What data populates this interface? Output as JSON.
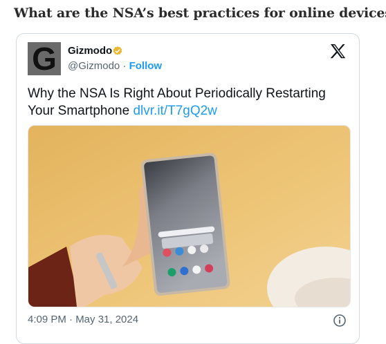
{
  "article": {
    "heading": "What are the NSA’s best practices for online devices?"
  },
  "tweet": {
    "avatar_letter": "G",
    "author_name": "Gizmodo",
    "handle": "@Gizmodo",
    "separator": " · ",
    "follow_label": "Follow",
    "text": "Why the NSA Is Right About Periodically Restarting Your Smartphone ",
    "link_text": "dlvr.it/T7gQ2w",
    "timestamp": "4:09 PM · May 31, 2024",
    "photo_description": "hand holding smartphone"
  },
  "colors": {
    "link": "#1d9bf0",
    "badge": "#e8b830",
    "text": "#0f1419",
    "muted": "#536471"
  },
  "icons": [
    "verified-badge-icon",
    "x-logo-icon",
    "info-icon"
  ]
}
